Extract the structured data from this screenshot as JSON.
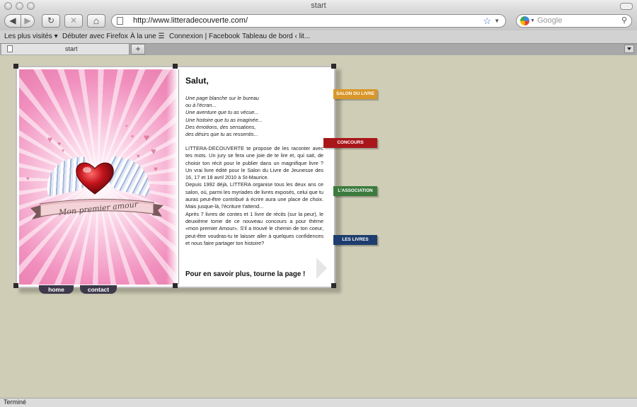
{
  "window": {
    "title": "start"
  },
  "nav": {
    "back_glyph": "◀",
    "forward_glyph": "▶",
    "reload_glyph": "↻",
    "stop_glyph": "✕",
    "home_glyph": "⌂"
  },
  "address": {
    "url": "http://www.litteradecouverte.com/",
    "bookmark_icon": "star-icon"
  },
  "search": {
    "placeholder": "Google"
  },
  "bookmarks": [
    "Les plus visités ▾",
    "Débuter avec Firefox",
    "À la une ☰",
    "Connexion | Facebook",
    "Tableau de bord ‹ lit..."
  ],
  "tabs": [
    {
      "label": "start"
    }
  ],
  "new_tab_label": "+",
  "status": {
    "text": "Terminé"
  },
  "book": {
    "cover_title": "Mon premier amour",
    "greeting": "Salut,",
    "poem": [
      "Une page blanche sur le bureau",
      "ou à l'écran...",
      "Une aventure que tu as vécue...",
      "Une histoire que tu as imaginée...",
      "Des émotions, des sensations,",
      "des désirs que tu as ressentis..."
    ],
    "paragraphs": [
      "LITTERA-DECOUVERTE te propose de les raconter avec tes mots. Un jury se fera une joie de te lire et, qui sait, de choisir ton récit pour le publier dans un magnifique livre ? Un vrai livre édité pour le Salon du Livre de Jeunesse des 16, 17 et 18 avril 2010 à St-Maurice.",
      "Depuis 1992 déjà, LITTERA organise tous les deux ans ce salon, où, parmi les myriades de livres exposés, celui que tu auras peut-être contribué à écrire aura une place de choix. Mais jusque-là, l'écriture t'attend...",
      "Après 7 livres de contes et 1 livre de récits (sur la peur), le deuxième tome de ce nouveau concours a pour thème «mon premier Amour». S'il a trouvé le chemin de ton coeur, peut-être voudras-tu te laisser aller à quelques confidences et nous faire partager ton histoire?"
    ],
    "cta": "Pour en savoir plus, tourne la page !"
  },
  "side_tabs": [
    {
      "label": "SALON DU LIVRE",
      "color": "#d9972a"
    },
    {
      "label": "CONCOURS",
      "color": "#a8161a"
    },
    {
      "label": "L'ASSOCIATION",
      "color": "#3c7a3e"
    },
    {
      "label": "LES LIVRES",
      "color": "#1e3d6e"
    }
  ],
  "bottom_nav": {
    "home": "home",
    "contact": "contact"
  }
}
